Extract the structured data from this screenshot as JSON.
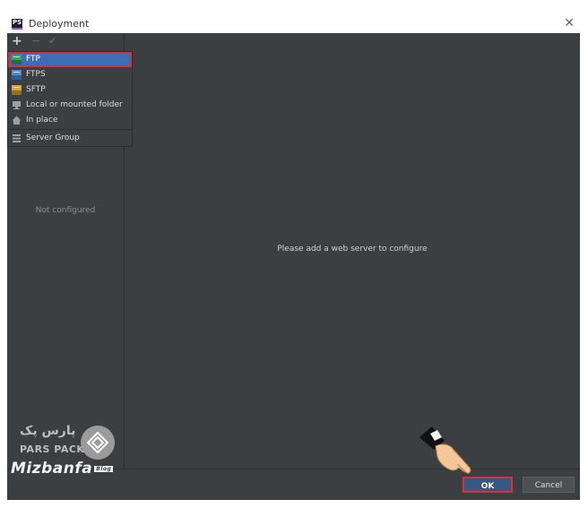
{
  "window": {
    "icon_text": "PS",
    "title": "Deployment",
    "close_glyph": "✕"
  },
  "toolbar": {
    "add": "+",
    "remove": "−",
    "apply": "✔"
  },
  "server_types": [
    {
      "label": "FTP",
      "icon": "ftp-icon",
      "color": "#3fa35a",
      "selected": true
    },
    {
      "label": "FTPS",
      "icon": "ftps-icon",
      "color": "#4a8fd8"
    },
    {
      "label": "SFTP",
      "icon": "sftp-icon",
      "color": "#d9a53b"
    },
    {
      "label": "Local or mounted folder",
      "icon": "folder-icon",
      "color": "#9aa0a6"
    },
    {
      "label": "In place",
      "icon": "home-icon",
      "color": "#9aa0a6"
    }
  ],
  "server_group": {
    "label": "Server Group",
    "icon": "list-icon"
  },
  "left_empty": "Not configured",
  "right_empty": "Please add a web server to configure",
  "buttons": {
    "ok": "OK",
    "cancel": "Cancel"
  },
  "watermark": {
    "pars_fa": "پارس پک",
    "pars_en": "PARS PACK",
    "brand": "Mizbanfa",
    "brand_tag": "Blog"
  },
  "colors": {
    "selection": "#3d6eb5",
    "highlight": "#d82f3a",
    "panel": "#3c3f41"
  }
}
